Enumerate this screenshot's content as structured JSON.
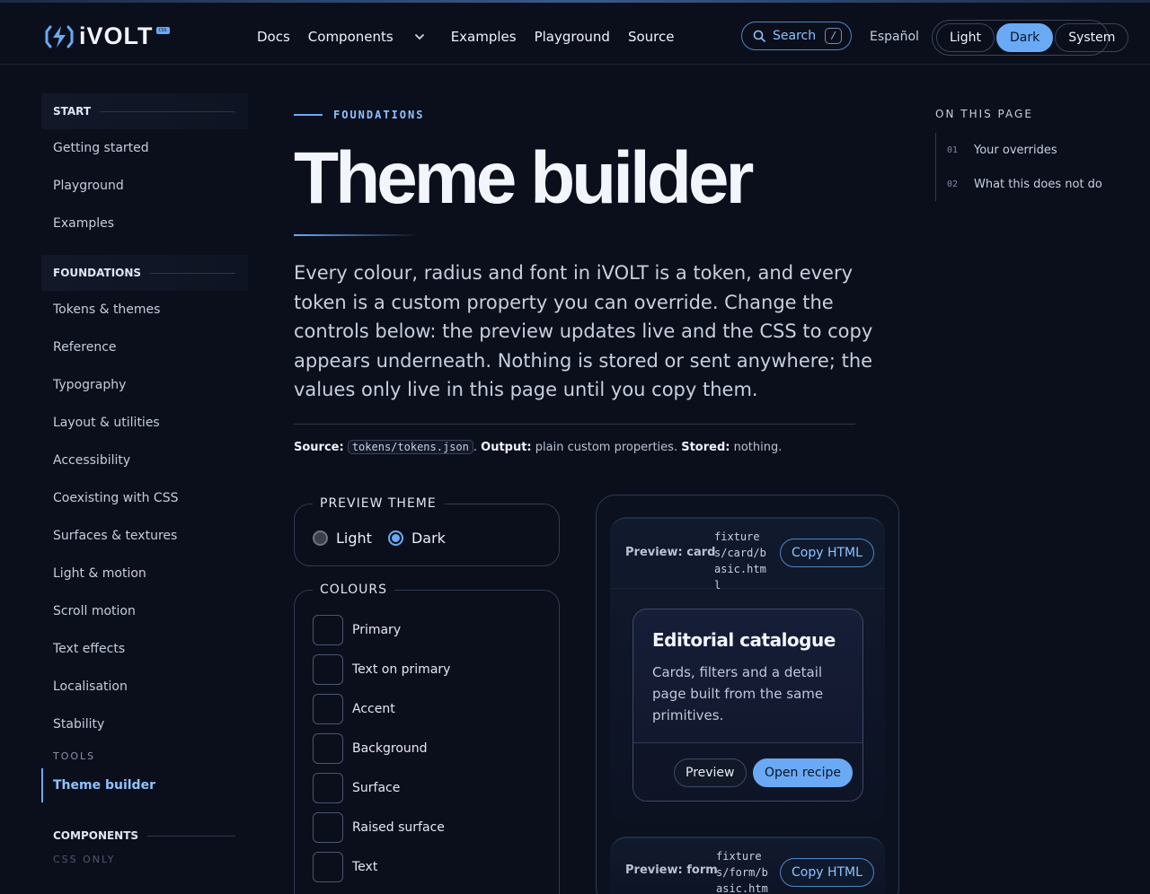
{
  "header": {
    "logo_text": "iVOLT",
    "logo_badge": "CSS",
    "nav": [
      "Docs",
      "Components",
      "Examples",
      "Playground",
      "Source"
    ],
    "search_label": "Search",
    "search_kbd": "/",
    "language": "Español",
    "theme_options": [
      "Light",
      "Dark",
      "System"
    ],
    "theme_active": "Dark"
  },
  "sidebar": {
    "start_label": "START",
    "start_items": [
      "Getting started",
      "Playground",
      "Examples"
    ],
    "foundations_label": "FOUNDATIONS",
    "foundations_items": [
      "Tokens & themes",
      "Reference",
      "Typography",
      "Layout & utilities",
      "Accessibility",
      "Coexisting with CSS",
      "Surfaces & textures",
      "Light & motion",
      "Scroll motion",
      "Text effects",
      "Localisation",
      "Stability"
    ],
    "tools_label": "TOOLS",
    "tools_active": "Theme builder",
    "components_label": "COMPONENTS",
    "css_only_label": "CSS ONLY"
  },
  "main": {
    "eyebrow": "FOUNDATIONS",
    "title": "Theme builder",
    "lead": "Every colour, radius and font in iVOLT is a token, and every token is a custom property you can override. Change the controls below: the preview updates live and the CSS to copy appears underneath. Nothing is stored or sent anywhere; the values only live in this page until you copy them.",
    "source_label": "Source:",
    "source_file": "tokens/tokens.json",
    "output_label": "Output:",
    "output_value": "plain custom properties.",
    "stored_label": "Stored:",
    "stored_value": "nothing."
  },
  "preview_theme": {
    "legend": "PREVIEW THEME",
    "options": [
      "Light",
      "Dark"
    ],
    "selected": "Dark"
  },
  "colours": {
    "legend": "COLOURS",
    "items": [
      {
        "label": "Primary",
        "color": "#6aaaf5"
      },
      {
        "label": "Text on primary",
        "color": "#0f1530"
      },
      {
        "label": "Accent",
        "color": "#7ad2fa"
      },
      {
        "label": "Background",
        "color": "#0a0d18"
      },
      {
        "label": "Surface",
        "color": "#0e1322"
      },
      {
        "label": "Raised surface",
        "color": "#141a36"
      },
      {
        "label": "Text",
        "color": "#f4f5fb"
      }
    ]
  },
  "preview": {
    "card": {
      "label": "Preview: card",
      "path": "fixtures/card/basic.html",
      "copy": "Copy HTML",
      "demo_title": "Editorial catalogue",
      "demo_text": "Cards, filters and a detail page built from the same primitives.",
      "btn_preview": "Preview",
      "btn_open": "Open recipe"
    },
    "form": {
      "label": "Preview: form",
      "path": "fixtures/form/basic.html",
      "copy": "Copy HTML"
    }
  },
  "toc": {
    "title": "ON THIS PAGE",
    "items": [
      {
        "num": "01",
        "label": "Your overrides"
      },
      {
        "num": "02",
        "label": "What this does not do"
      }
    ]
  }
}
